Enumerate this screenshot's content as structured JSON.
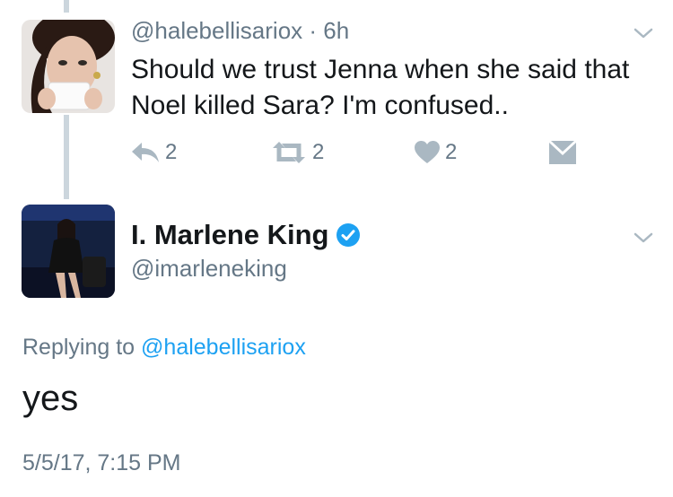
{
  "parent_tweet": {
    "handle": "@halebellisariox",
    "separator": " · ",
    "time": "6h",
    "text": "Should we trust Jenna when she said that Noel killed Sara? I'm confused..",
    "reply_count": "2",
    "retweet_count": "2",
    "like_count": "2"
  },
  "reply_tweet": {
    "name": "I. Marlene King",
    "handle": "@imarleneking",
    "replying_prefix": "Replying to ",
    "replying_handle": "@halebellisariox",
    "text": "yes",
    "timestamp": "5/5/17, 7:15 PM"
  },
  "icons": {
    "reply": "reply-icon",
    "retweet": "retweet-icon",
    "like": "heart-icon",
    "dm": "envelope-icon",
    "verified": "verified-badge-icon",
    "more": "chevron-down-icon"
  },
  "colors": {
    "text": "#14171a",
    "secondary": "#657786",
    "icon": "#aab8c2",
    "link": "#1da1f2",
    "verified": "#1da1f2",
    "thread_line": "#ccd6dd"
  }
}
